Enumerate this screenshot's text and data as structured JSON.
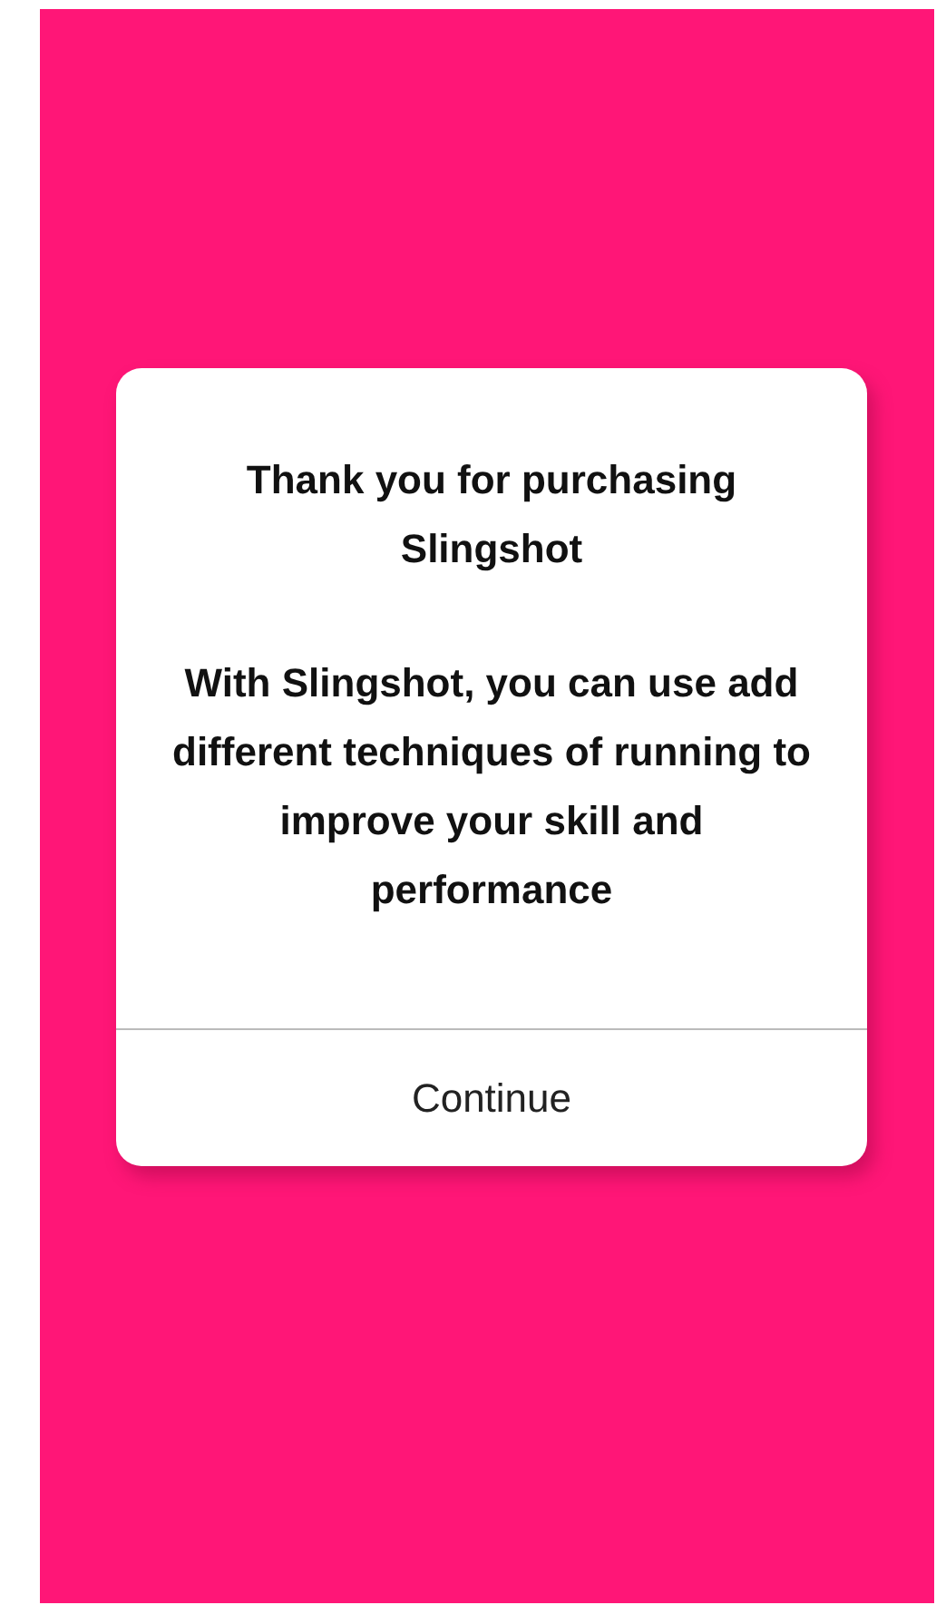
{
  "dialog": {
    "title": "Thank you for purchasing Slingshot",
    "message": "With Slingshot, you can use add different techniques of running to improve your skill and performance",
    "buttons": [
      "Continue"
    ]
  }
}
